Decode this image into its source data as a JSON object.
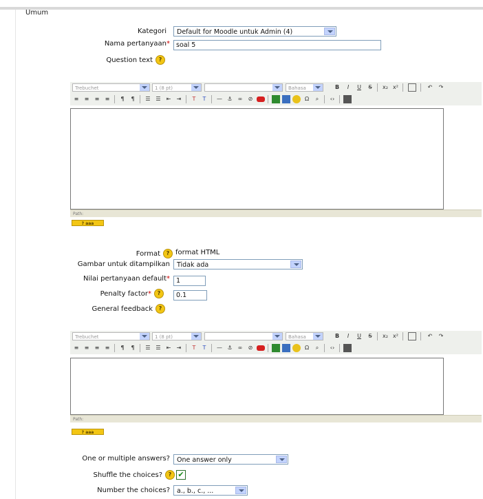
{
  "fieldset": {
    "legend": "Umum"
  },
  "kategori": {
    "label": "Kategori",
    "value": "Default for Moodle untuk Admin (4)"
  },
  "nama": {
    "label": "Nama pertanyaan",
    "value": "soal 5"
  },
  "question_text": {
    "label": "Question text"
  },
  "editor": {
    "font_family": "Trebuchet",
    "font_size": "1 (8 pt)",
    "heading": "",
    "lang": "Bahasa",
    "path": "Path:"
  },
  "format": {
    "label": "Format",
    "value": "format HTML"
  },
  "gambar": {
    "label": "Gambar untuk ditampilkan",
    "value": "Tidak ada"
  },
  "nilai": {
    "label": "Nilai pertanyaan default",
    "value": "1"
  },
  "penalty": {
    "label": "Penalty factor",
    "value": "0.1"
  },
  "general_feedback": {
    "label": "General feedback"
  },
  "single": {
    "label": "One or multiple answers?",
    "value": "One answer only"
  },
  "shuffle": {
    "label": "Shuffle the choices?",
    "checked": true,
    "mark": "✔"
  },
  "numbering": {
    "label": "Number the choices?",
    "value": "a., b., c., ..."
  },
  "help_tag": "? aaa",
  "help_icon": "?",
  "colors": {
    "required": "#cc0000",
    "help": "#f3c614",
    "arrow_bg": "#c3d3fd",
    "editor_bar": "#eef0ec"
  }
}
